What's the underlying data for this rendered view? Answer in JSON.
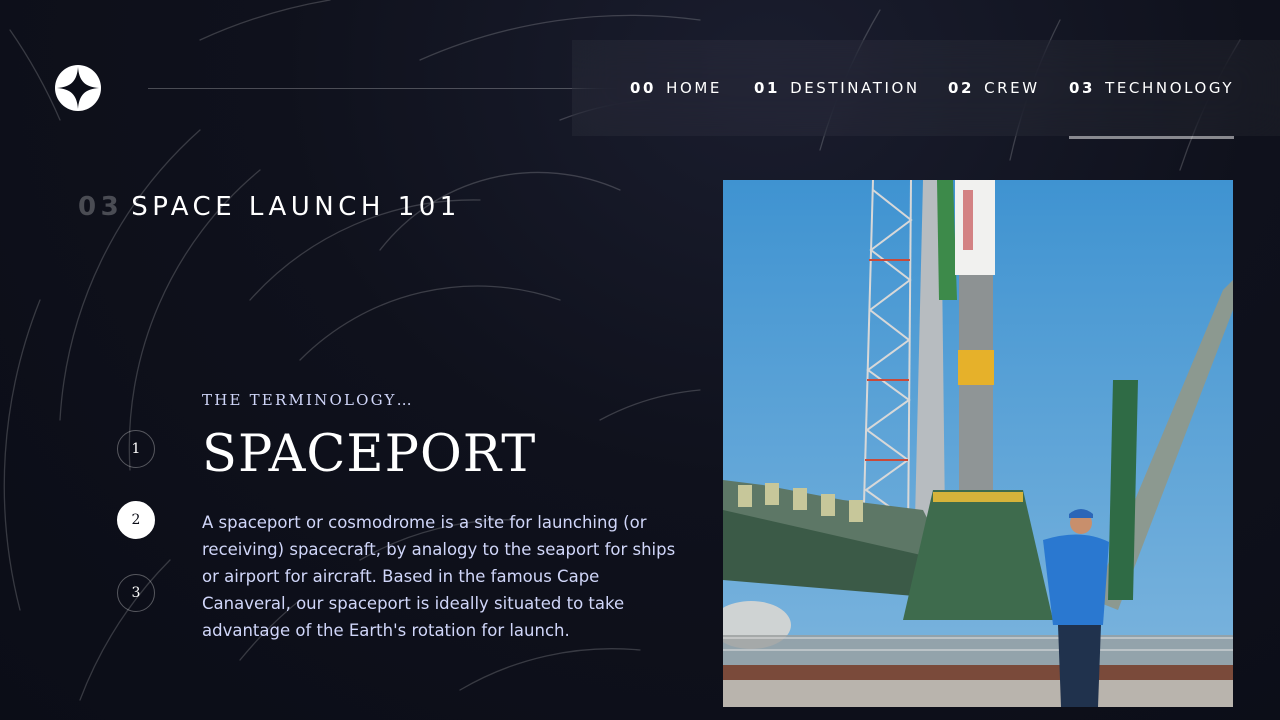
{
  "header": {
    "logo_icon": "star-icon",
    "nav": [
      {
        "num": "00",
        "label": "HOME",
        "active": false
      },
      {
        "num": "01",
        "label": "DESTINATION",
        "active": false
      },
      {
        "num": "02",
        "label": "CREW",
        "active": false
      },
      {
        "num": "03",
        "label": "TECHNOLOGY",
        "active": true
      }
    ]
  },
  "page": {
    "num": "03",
    "title": "SPACE LAUNCH 101"
  },
  "steps": [
    "1",
    "2",
    "3"
  ],
  "active_step": "2",
  "content": {
    "eyebrow": "THE TERMINOLOGY…",
    "title": "SPACEPORT",
    "description": "A spaceport or cosmodrome is a site for launching (or receiving) spacecraft, by analogy to the seaport for ships or airport for aircraft. Based in the famous Cape Canaveral, our spaceport is ideally situated to take advantage of the Earth's rotation for launch."
  },
  "colors": {
    "background": "#0b0d17",
    "text_light": "#d0d6f9",
    "white": "#ffffff"
  }
}
